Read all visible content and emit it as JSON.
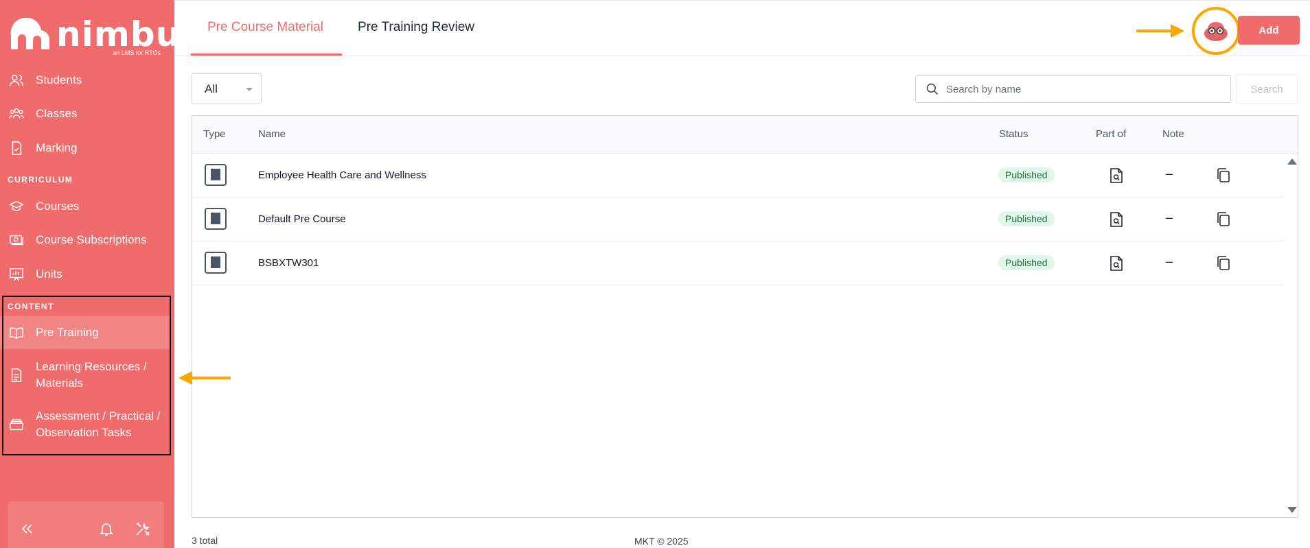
{
  "brand": {
    "name": "nimbu",
    "tagline": "an LMS for RTOs"
  },
  "sidebar": {
    "items": [
      {
        "label": "Students",
        "icon": "students-icon"
      },
      {
        "label": "Classes",
        "icon": "classes-icon"
      },
      {
        "label": "Marking",
        "icon": "marking-icon"
      }
    ],
    "curriculum_heading": "CURRICULUM",
    "curriculum_items": [
      {
        "label": "Courses",
        "icon": "courses-icon"
      },
      {
        "label": "Course Subscriptions",
        "icon": "subscriptions-icon"
      },
      {
        "label": "Units",
        "icon": "units-icon"
      }
    ],
    "content_heading": "CONTENT",
    "content_items": [
      {
        "label": "Pre Training",
        "icon": "book-open-icon",
        "active": true
      },
      {
        "label_line1": "Learning Resources /",
        "label_line2": "Materials",
        "icon": "document-icon"
      },
      {
        "label_line1": "Assessment / Practical /",
        "label_line2": "Observation Tasks",
        "icon": "tray-icon"
      }
    ],
    "footer_icons": [
      "collapse-icon",
      "bell-icon",
      "tools-icon"
    ]
  },
  "header": {
    "tabs": [
      {
        "label": "Pre Course Material",
        "active": true
      },
      {
        "label": "Pre Training Review",
        "active": false
      }
    ],
    "add_label": "Add"
  },
  "filters": {
    "type_selected": "All",
    "search_placeholder": "Search by name",
    "search_button": "Search"
  },
  "table": {
    "columns": [
      "Type",
      "Name",
      "Status",
      "Part of",
      "Note"
    ],
    "rows": [
      {
        "name": "Employee Health Care and Wellness",
        "status": "Published",
        "note": "–"
      },
      {
        "name": "Default Pre Course",
        "status": "Published",
        "note": "–"
      },
      {
        "name": "BSBXTW301",
        "status": "Published",
        "note": "–"
      }
    ]
  },
  "footer": {
    "total": "3 total",
    "copyright": "MKT © 2025"
  },
  "colors": {
    "brand": "#f06c6c",
    "annotation": "#ffa500",
    "published_bg": "#e1f7ec",
    "published_text": "#16703f"
  }
}
